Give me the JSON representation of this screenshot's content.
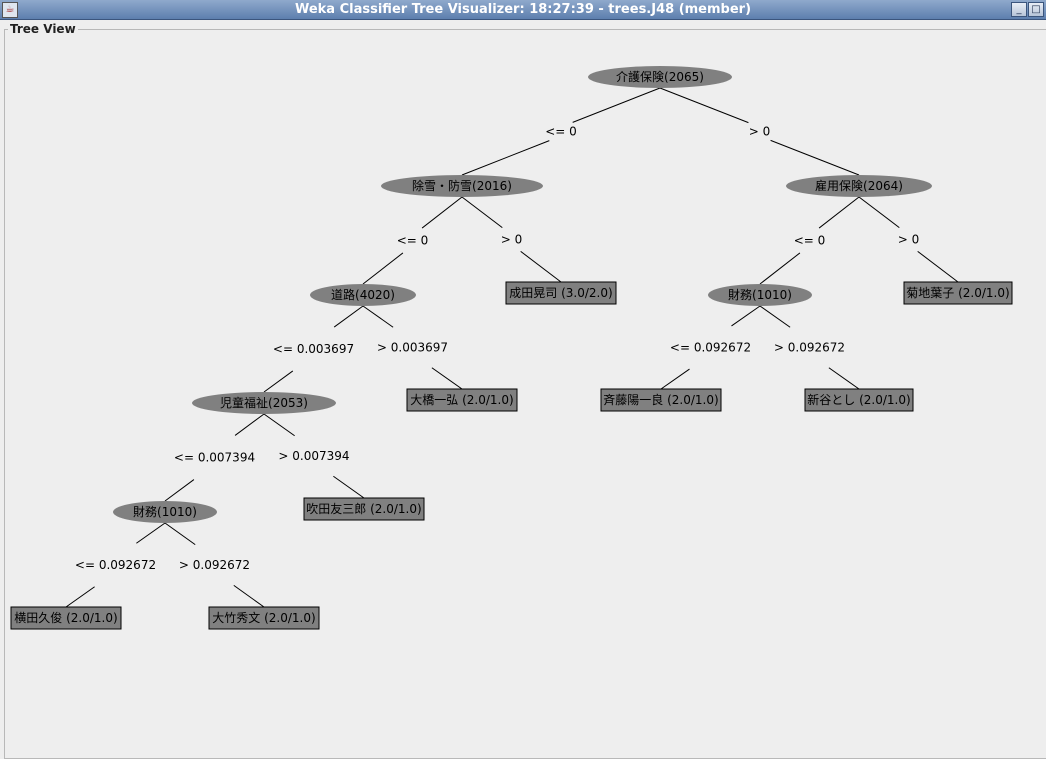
{
  "window": {
    "title": "Weka Classifier Tree Visualizer: 18:27:39 - trees.J48 (member)",
    "minimize_glyph": "_",
    "maximize_glyph": "□",
    "icon": "java-app-icon"
  },
  "panel": {
    "title": "Tree View"
  },
  "colors": {
    "node_fill": "#808080",
    "leaf_fill": "#808080",
    "edge": "#000000",
    "background": "#eeeeee"
  },
  "tree": {
    "nodes": [
      {
        "id": "n1",
        "type": "decision",
        "label": "介護保険(2065)"
      },
      {
        "id": "n2",
        "type": "decision",
        "label": "除雪・防雪(2016)"
      },
      {
        "id": "n3",
        "type": "decision",
        "label": "雇用保険(2064)"
      },
      {
        "id": "n4",
        "type": "decision",
        "label": "道路(4020)"
      },
      {
        "id": "n5",
        "type": "leaf",
        "label": "成田晃司 (3.0/2.0)"
      },
      {
        "id": "n6",
        "type": "decision",
        "label": "財務(1010)"
      },
      {
        "id": "n7",
        "type": "leaf",
        "label": "菊地葉子 (2.0/1.0)"
      },
      {
        "id": "n8",
        "type": "decision",
        "label": "児童福祉(2053)"
      },
      {
        "id": "n9",
        "type": "leaf",
        "label": "大橋一弘 (2.0/1.0)"
      },
      {
        "id": "n10",
        "type": "leaf",
        "label": "斉藤陽一良 (2.0/1.0)"
      },
      {
        "id": "n11",
        "type": "leaf",
        "label": "新谷とし (2.0/1.0)"
      },
      {
        "id": "n12",
        "type": "decision",
        "label": "財務(1010)"
      },
      {
        "id": "n13",
        "type": "leaf",
        "label": "吹田友三郎 (2.0/1.0)"
      },
      {
        "id": "n14",
        "type": "leaf",
        "label": "横田久俊 (2.0/1.0)"
      },
      {
        "id": "n15",
        "type": "leaf",
        "label": "大竹秀文 (2.0/1.0)"
      }
    ],
    "edges": [
      {
        "from": "n1",
        "to": "n2",
        "label": "<= 0"
      },
      {
        "from": "n1",
        "to": "n3",
        "label": "> 0"
      },
      {
        "from": "n2",
        "to": "n4",
        "label": "<= 0"
      },
      {
        "from": "n2",
        "to": "n5",
        "label": "> 0"
      },
      {
        "from": "n3",
        "to": "n6",
        "label": "<= 0"
      },
      {
        "from": "n3",
        "to": "n7",
        "label": "> 0"
      },
      {
        "from": "n4",
        "to": "n8",
        "label": "<= 0.003697"
      },
      {
        "from": "n4",
        "to": "n9",
        "label": "> 0.003697"
      },
      {
        "from": "n6",
        "to": "n10",
        "label": "<= 0.092672"
      },
      {
        "from": "n6",
        "to": "n11",
        "label": "> 0.092672"
      },
      {
        "from": "n8",
        "to": "n12",
        "label": "<= 0.007394"
      },
      {
        "from": "n8",
        "to": "n13",
        "label": "> 0.007394"
      },
      {
        "from": "n12",
        "to": "n14",
        "label": "<= 0.092672"
      },
      {
        "from": "n12",
        "to": "n15",
        "label": "> 0.092672"
      }
    ]
  }
}
